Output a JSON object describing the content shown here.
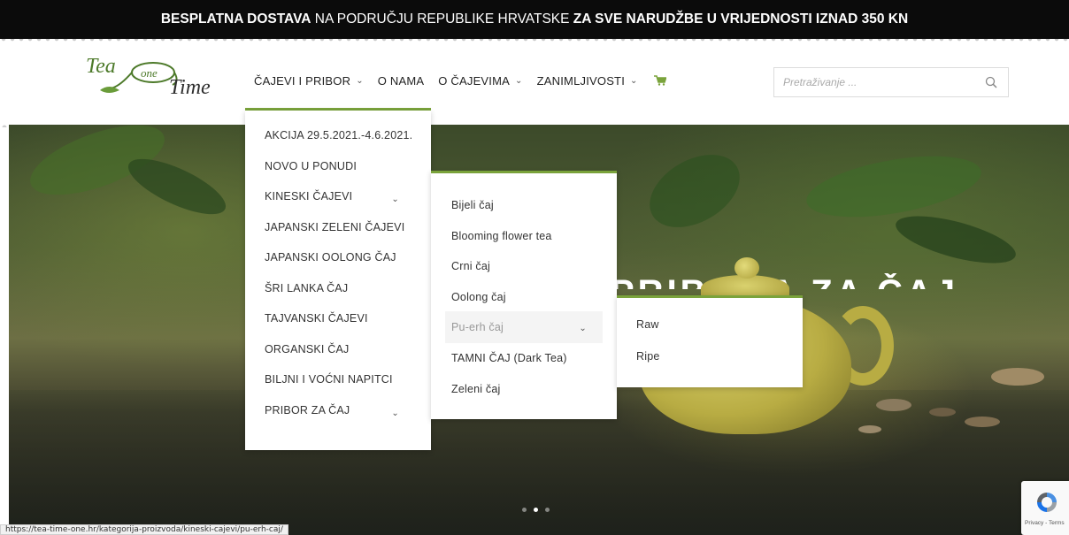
{
  "promo": {
    "part1_bold": "BESPLATNA DOSTAVA",
    "part2": " NA PODRUČJU REPUBLIKE HRVATSKE ",
    "part3_bold": "ZA SVE NARUDŽBE U VRIJEDNOSTI IZNAD 350 KN"
  },
  "logo": {
    "line1": "Tea",
    "badge": "one",
    "line2": "Time"
  },
  "nav": {
    "items": [
      {
        "label": "ČAJEVI I PRIBOR",
        "has_dropdown": true
      },
      {
        "label": "O NAMA",
        "has_dropdown": false
      },
      {
        "label": "O ČAJEVIMA",
        "has_dropdown": true
      },
      {
        "label": "ZANIMLJIVOSTI",
        "has_dropdown": true
      }
    ],
    "chevron": "⌄",
    "cart_icon": "cart-icon"
  },
  "search": {
    "placeholder": "Pretraživanje ...",
    "icon": "search-icon"
  },
  "menu_level1": [
    {
      "label": "AKCIJA 29.5.2021.-4.6.2021."
    },
    {
      "label": "NOVO U PONUDI"
    },
    {
      "label": "KINESKI ČAJEVI",
      "submenu": true
    },
    {
      "label": "JAPANSKI ZELENI ČAJEVI"
    },
    {
      "label": "JAPANSKI OOLONG ČAJ"
    },
    {
      "label": "ŠRI LANKA ČAJ"
    },
    {
      "label": "TAJVANSKI ČAJEVI"
    },
    {
      "label": "ORGANSKI ČAJ"
    },
    {
      "label": "BILJNI I VOĆNI NAPITCI"
    },
    {
      "label": "PRIBOR ZA ČAJ",
      "submenu": true
    }
  ],
  "menu_level2": [
    {
      "label": "Bijeli čaj"
    },
    {
      "label": "Blooming flower tea"
    },
    {
      "label": "Crni čaj"
    },
    {
      "label": "Oolong čaj"
    },
    {
      "label": "Pu-erh čaj",
      "submenu": true,
      "hovered": true
    },
    {
      "label": "TAMNI ČAJ (Dark Tea)"
    },
    {
      "label": "Zeleni čaj"
    }
  ],
  "menu_level3": [
    {
      "label": "Raw"
    },
    {
      "label": "Ripe"
    }
  ],
  "hero": {
    "title": "PRIBORA ZA ČAJ",
    "slides_total": 3,
    "active_slide": 2
  },
  "status_url": "https://tea-time-one.hr/kategorija-proizvoda/kineski-cajevi/pu-erh-caj/",
  "recaptcha": {
    "text": "Privacy - Terms"
  },
  "colors": {
    "accent": "#7aa33b",
    "promo_bg": "#0b0b0b",
    "cart": "#7aa33b"
  }
}
